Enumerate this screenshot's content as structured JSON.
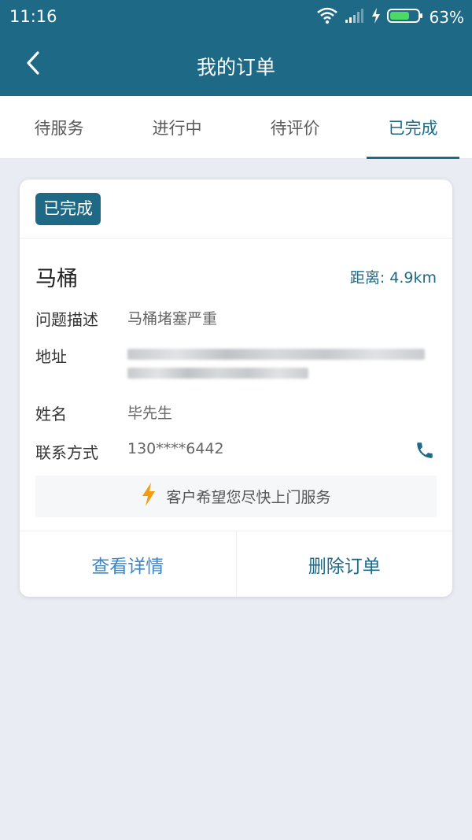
{
  "status_bar": {
    "time": "11:16",
    "battery_pct": "63%"
  },
  "app_bar": {
    "title": "我的订单"
  },
  "tabs": [
    {
      "label": "待服务",
      "active": false
    },
    {
      "label": "进行中",
      "active": false
    },
    {
      "label": "待评价",
      "active": false
    },
    {
      "label": "已完成",
      "active": true
    }
  ],
  "order": {
    "status_badge": "已完成",
    "service": "马桶",
    "distance": "距离: 4.9km",
    "fields": {
      "problem_label": "问题描述",
      "problem_value": "马桶堵塞严重",
      "address_label": "地址",
      "name_label": "姓名",
      "name_value": "毕先生",
      "contact_label": "联系方式",
      "contact_value": "130****6442"
    },
    "notice": "客户希望您尽快上门服务",
    "actions": {
      "detail": "查看详情",
      "delete": "删除订单"
    }
  },
  "colors": {
    "primary": "#1e6a86",
    "link": "#3b86c8",
    "accent": "#f39c12"
  },
  "icons": [
    "back-arrow-icon",
    "wifi-icon",
    "signal-icon",
    "charging-icon",
    "battery-icon",
    "phone-icon",
    "lightning-icon"
  ]
}
